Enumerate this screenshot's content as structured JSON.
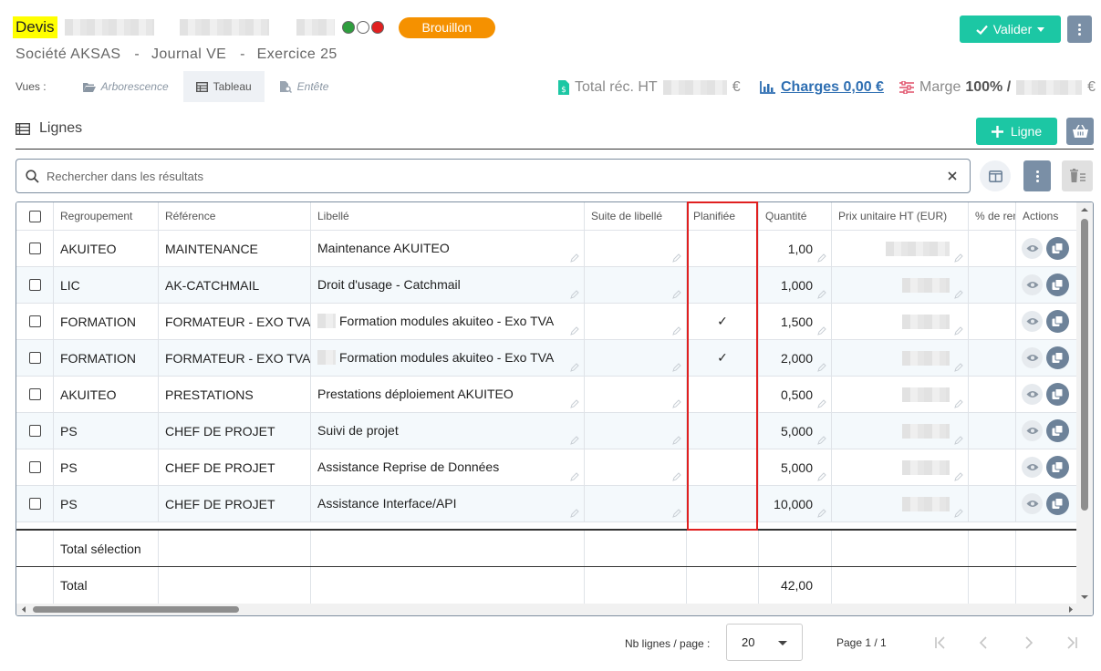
{
  "header": {
    "doc_type": "Devis",
    "status": "Brouillon",
    "company": "Société AKSAS",
    "journal": "Journal VE",
    "exercise": "Exercice 25",
    "separator": "-",
    "status_dots": [
      "#2e9e3e",
      "#ffffff",
      "#e02020"
    ],
    "validate_label": "Valider"
  },
  "views": {
    "label": "Vues :",
    "items": [
      "Arborescence",
      "Tableau",
      "Entête"
    ],
    "active": "Tableau"
  },
  "stats": {
    "total_label": "Total réc. HT",
    "currency": "€",
    "charges_label": "Charges 0,00 €",
    "marge_label": "Marge",
    "marge_pct": "100% /"
  },
  "section": {
    "title": "Lignes",
    "add_label": "Ligne"
  },
  "search": {
    "placeholder": "Rechercher dans les résultats"
  },
  "table": {
    "columns": [
      "Regroupement",
      "Référence",
      "Libellé",
      "Suite de libellé",
      "Planifiée",
      "Quantité",
      "Prix unitaire HT (EUR)",
      "% de rem",
      "Actions"
    ],
    "rows": [
      {
        "group": "AKUITEO",
        "ref": "MAINTENANCE",
        "label": "Maintenance AKUITEO",
        "planned": false,
        "qty": "1,00"
      },
      {
        "group": "LIC",
        "ref": "AK-CATCHMAIL",
        "label": "Droit d'usage - Catchmail",
        "planned": false,
        "qty": "1,000"
      },
      {
        "group": "FORMATION",
        "ref": "FORMATEUR - EXO TVA",
        "label": "Formation modules akuiteo - Exo TVA",
        "planned": true,
        "qty": "1,500"
      },
      {
        "group": "FORMATION",
        "ref": "FORMATEUR - EXO TVA",
        "label": "Formation modules akuiteo - Exo TVA",
        "planned": true,
        "qty": "2,000"
      },
      {
        "group": "AKUITEO",
        "ref": "PRESTATIONS",
        "label": "Prestations déploiement AKUITEO",
        "planned": false,
        "qty": "0,500"
      },
      {
        "group": "PS",
        "ref": "CHEF DE PROJET",
        "label": "Suivi de projet",
        "planned": false,
        "qty": "5,000"
      },
      {
        "group": "PS",
        "ref": "CHEF DE PROJET",
        "label": "Assistance Reprise de Données",
        "planned": false,
        "qty": "5,000"
      },
      {
        "group": "PS",
        "ref": "CHEF DE PROJET",
        "label": "Assistance Interface/API",
        "planned": false,
        "qty": "10,000"
      }
    ],
    "check_mark": "✓",
    "selection_total_label": "Total sélection",
    "total_label": "Total",
    "total_qty": "42,00"
  },
  "pagination": {
    "rows_label": "Nb lignes / page :",
    "rows_value": "20",
    "page_label": "Page 1 / 1"
  },
  "colors": {
    "accent": "#1cc7a4",
    "secondary": "#7a8fa6",
    "status": "#f59100",
    "highlight": "#e02020"
  }
}
